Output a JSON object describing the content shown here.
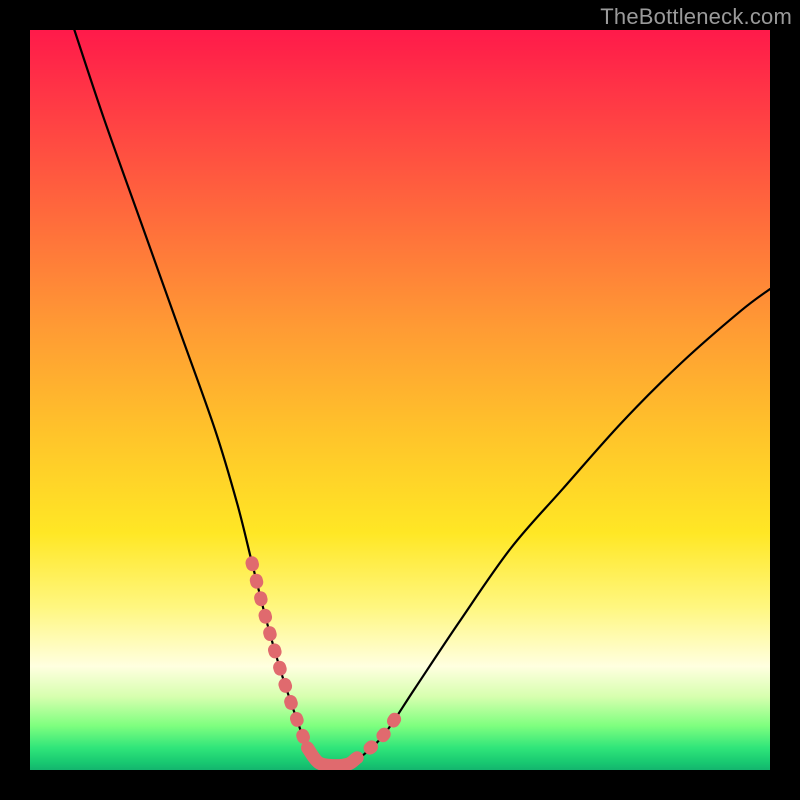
{
  "watermark": {
    "text": "TheBottleneck.com"
  },
  "chart_data": {
    "type": "line",
    "title": "",
    "xlabel": "",
    "ylabel": "",
    "ylim": [
      0,
      100
    ],
    "xlim": [
      0,
      100
    ],
    "series": [
      {
        "name": "curve",
        "x": [
          6,
          10,
          15,
          20,
          25,
          28,
          30,
          32,
          34,
          36,
          37.5,
          39,
          41,
          43,
          45,
          48,
          52,
          58,
          65,
          72,
          80,
          88,
          96,
          100
        ],
        "values": [
          100,
          88,
          74,
          60,
          46,
          36,
          28,
          20,
          13,
          7,
          3,
          1,
          0.6,
          0.8,
          2,
          5,
          11,
          20,
          30,
          38,
          47,
          55,
          62,
          65
        ]
      },
      {
        "name": "band-left",
        "x": [
          30,
          32,
          34,
          36,
          37.5
        ],
        "values": [
          28,
          20,
          13,
          7,
          3
        ]
      },
      {
        "name": "band-right",
        "x": [
          44,
          46,
          48,
          50
        ],
        "values": [
          1.5,
          3,
          5,
          8
        ]
      },
      {
        "name": "band-bottom",
        "x": [
          37.5,
          39,
          41,
          43,
          44
        ],
        "values": [
          3,
          1,
          0.6,
          0.8,
          1.5
        ]
      }
    ],
    "colors": {
      "curve": "#000000",
      "band": "#e06a6e"
    }
  }
}
